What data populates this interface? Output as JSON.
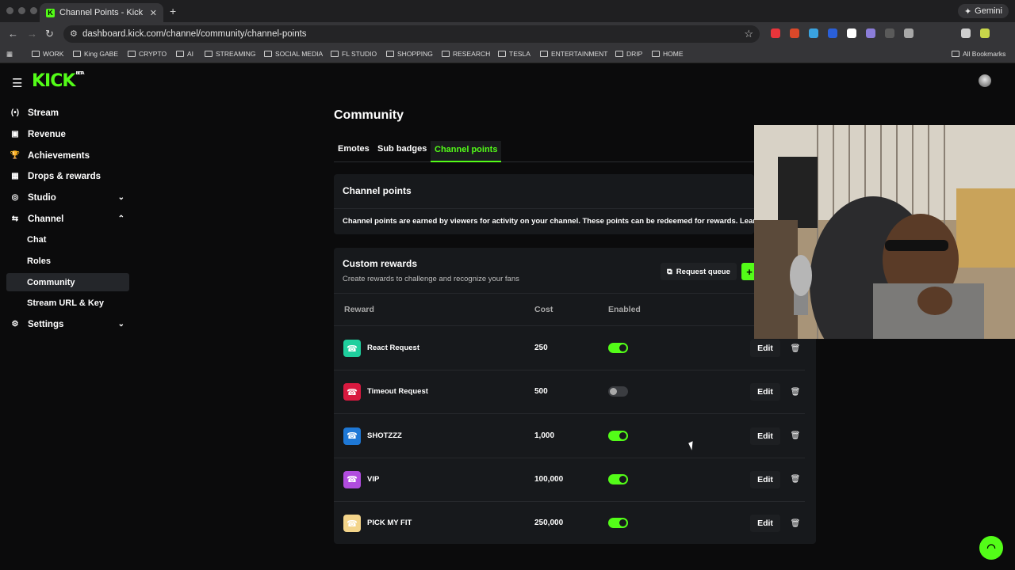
{
  "browser": {
    "tab_title": "Channel Points - Kick Dashb",
    "tab_close": "✕",
    "new_tab": "+",
    "gemini_label": "Gemini",
    "url": "dashboard.kick.com/channel/community/channel-points",
    "bookmarks": [
      "WORK",
      "King GABE",
      "CRYPTO",
      "AI",
      "STREAMING",
      "SOCIAL MEDIA",
      "FL STUDIO",
      "SHOPPING",
      "RESEARCH",
      "TESLA",
      "ENTERTAINMENT",
      "DRIP",
      "HOME"
    ],
    "all_bookmarks": "All Bookmarks",
    "extension_colors": [
      "#e8353b",
      "#d9482a",
      "#3aa3e0",
      "#2a5fd8",
      "#ffffff",
      "#8b7dd9",
      "#5a5a5a",
      "#a8a8a8",
      "#cfcfcf",
      "#c8d64a"
    ]
  },
  "brand": {
    "logo": "KICK",
    "logo_tag": "BETA",
    "accent": "#53fc18"
  },
  "sidebar": {
    "items": [
      {
        "label": "Stream",
        "icon": "stream-icon",
        "glyph": "(•)"
      },
      {
        "label": "Revenue",
        "icon": "revenue-icon",
        "glyph": "▣"
      },
      {
        "label": "Achievements",
        "icon": "trophy-icon",
        "glyph": "🏆"
      },
      {
        "label": "Drops & rewards",
        "icon": "gift-icon",
        "glyph": "▦"
      },
      {
        "label": "Studio",
        "icon": "studio-icon",
        "glyph": "◎",
        "chevron": "⌄"
      },
      {
        "label": "Channel",
        "icon": "channel-icon",
        "glyph": "⇆",
        "chevron": "⌃"
      },
      {
        "label": "Settings",
        "icon": "gear-icon",
        "glyph": "⚙",
        "chevron": "⌄"
      }
    ],
    "sub_items": [
      "Chat",
      "Roles",
      "Community",
      "Stream URL & Key"
    ]
  },
  "main": {
    "title": "Community",
    "tabs": [
      "Emotes",
      "Sub badges",
      "Channel points"
    ],
    "channel_points": {
      "heading": "Channel points",
      "description": "Channel points are earned by viewers for activity on your channel. These points can be redeemed for rewards. Learn"
    },
    "custom_rewards": {
      "heading": "Custom rewards",
      "subtitle": "Create rewards to challenge and recognize your fans",
      "request_queue": "Request queue",
      "add_label": "+",
      "columns": [
        "Reward",
        "Cost",
        "Enabled"
      ],
      "rows": [
        {
          "name": "React Request",
          "cost": "250",
          "enabled": true,
          "color": "#1fcf9e",
          "edit": "Edit"
        },
        {
          "name": "Timeout Request",
          "cost": "500",
          "enabled": false,
          "color": "#d8193f",
          "edit": "Edit"
        },
        {
          "name": "SHOTZZZ",
          "cost": "1,000",
          "enabled": true,
          "color": "#1e78d6",
          "edit": "Edit"
        },
        {
          "name": "VIP",
          "cost": "100,000",
          "enabled": true,
          "color": "#b14cdf",
          "edit": "Edit"
        },
        {
          "name": "PICK MY FIT",
          "cost": "250,000",
          "enabled": true,
          "color": "#f3d48a",
          "edit": "Edit"
        }
      ]
    }
  }
}
